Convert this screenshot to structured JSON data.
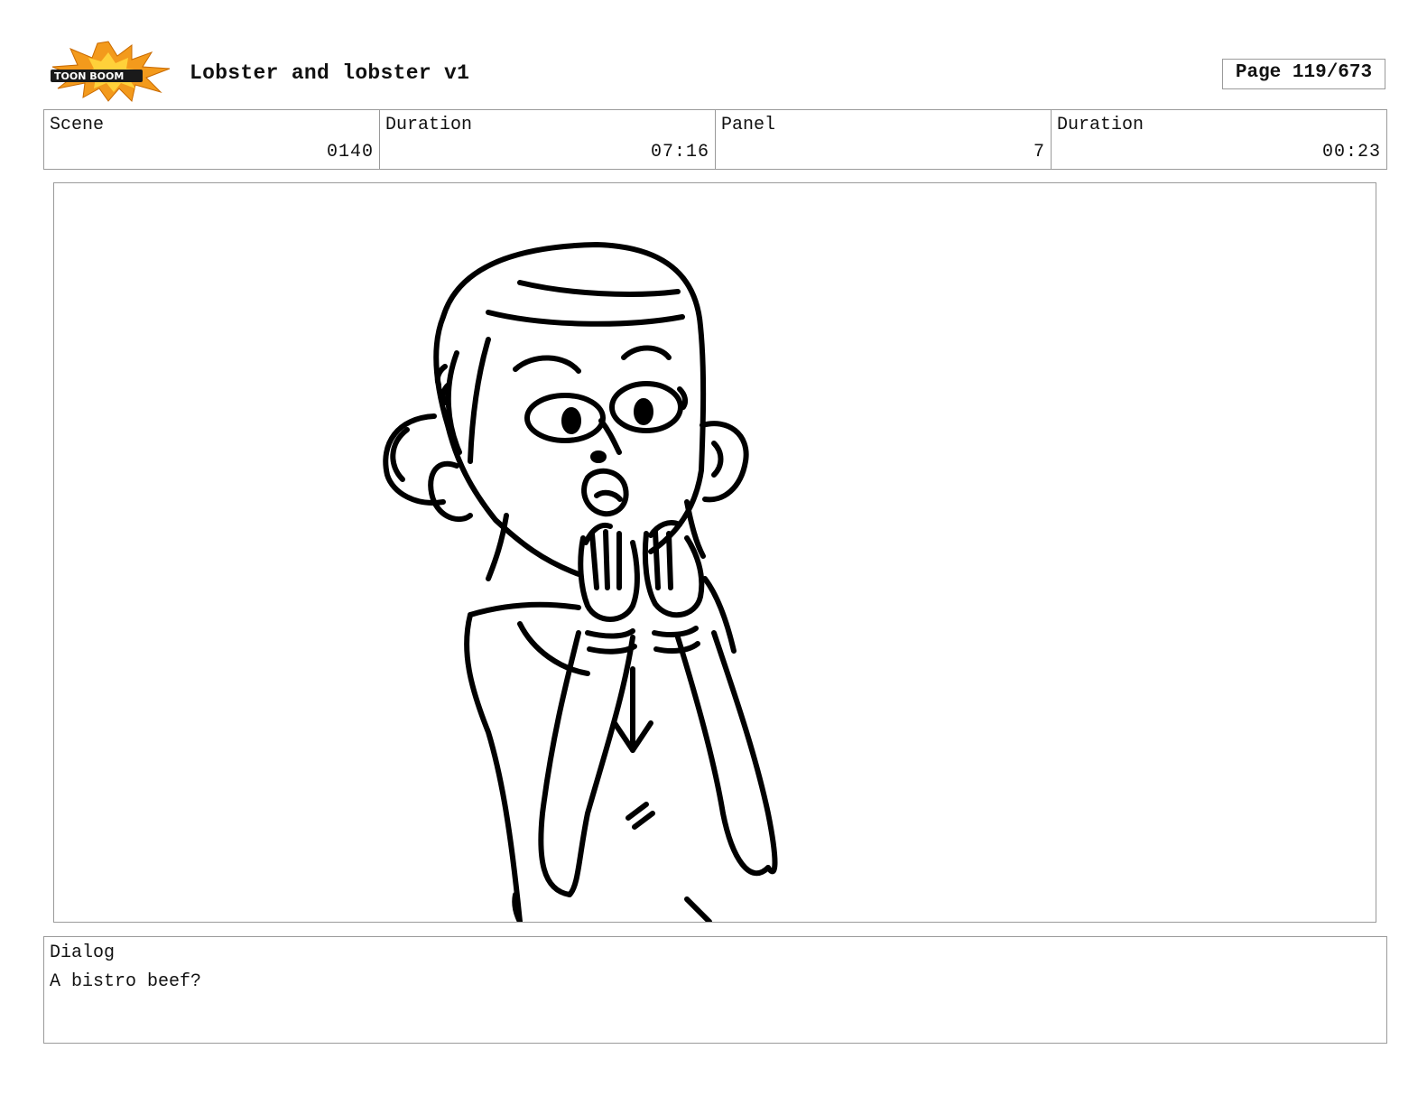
{
  "header": {
    "logo_text": "TOON BOOM",
    "title": "Lobster and lobster v1",
    "page": "Page 119/673"
  },
  "info": {
    "scene_label": "Scene",
    "scene_value": "0140",
    "scene_duration_label": "Duration",
    "scene_duration_value": "07:16",
    "panel_label": "Panel",
    "panel_value": "7",
    "panel_duration_label": "Duration",
    "panel_duration_value": "00:23"
  },
  "dialog": {
    "label": "Dialog",
    "text": "A bistro beef?"
  },
  "colors": {
    "logo_orange": "#f39a1c",
    "border": "#9a9a9a",
    "ink": "#000000"
  }
}
